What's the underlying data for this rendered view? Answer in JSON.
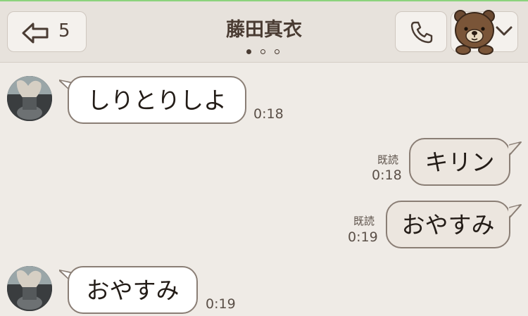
{
  "header": {
    "back_count": "5",
    "title": "藤田真衣",
    "pager_count": 3,
    "pager_active": 0
  },
  "icons": {
    "back": "back-arrow-icon",
    "call": "phone-icon",
    "menu": "brown-bear-sticker-icon",
    "chevron": "chevron-down-icon"
  },
  "messages": [
    {
      "side": "received",
      "text": "しりとりしよ",
      "time": "0:18"
    },
    {
      "side": "sent",
      "text": "キリン",
      "time": "0:18",
      "read": "既読"
    },
    {
      "side": "sent",
      "text": "おやすみ",
      "time": "0:19",
      "read": "既読"
    },
    {
      "side": "received",
      "text": "おやすみ",
      "time": "0:19"
    }
  ],
  "colors": {
    "background": "#efebe6",
    "header": "#e7e2dc",
    "received_bubble": "#ffffff",
    "sent_bubble": "#ece6df",
    "bubble_border": "#8a7e75",
    "accent_line": "#8cd37d"
  }
}
